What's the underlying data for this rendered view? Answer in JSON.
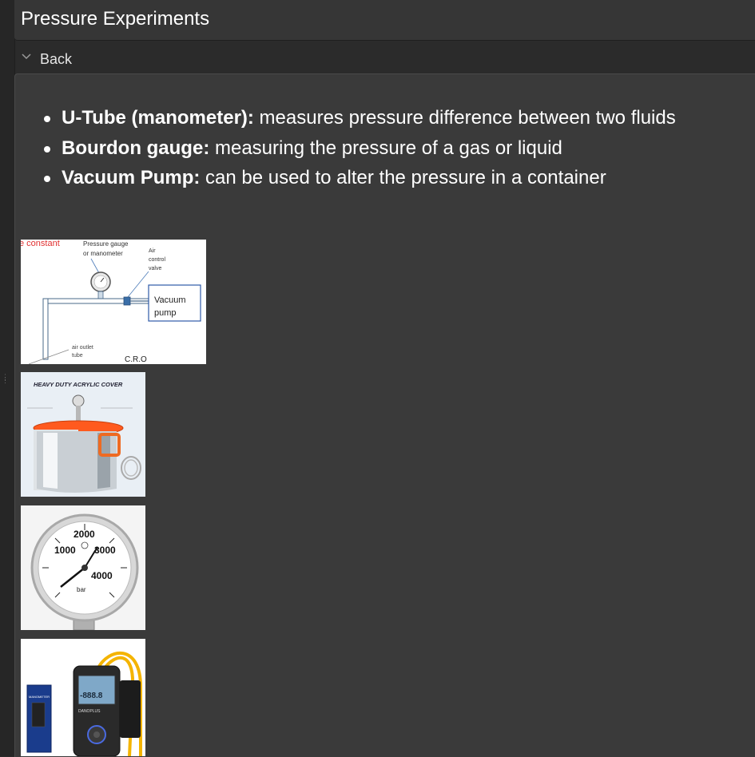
{
  "header": {
    "title": "Pressure Experiments"
  },
  "nav": {
    "back_label": "Back"
  },
  "bullets": [
    {
      "term": "U-Tube (manometer):",
      "desc": " measures pressure difference between two fluids"
    },
    {
      "term": "Bourdon gauge:",
      "desc": " measuring the pressure of a gas or liquid"
    },
    {
      "term": "Vacuum Pump:",
      "desc": " can be used to alter the pressure in a container"
    }
  ],
  "diagram": {
    "constant_text": "e constant",
    "gauge_label_1": "Pressure gauge",
    "gauge_label_2": "or manometer",
    "valve_label_1": "Air",
    "valve_label_2": "control",
    "valve_label_3": "valve",
    "pump_label_1": "Vacuum",
    "pump_label_2": "pump",
    "outlet_label_1": "air outlet",
    "outlet_label_2": "tube",
    "cro_label": "C.R.O"
  },
  "chamber_photo": {
    "caption": "HEAVY DUTY ACRYLIC COVER"
  },
  "gauge_photo": {
    "v2000": "2000",
    "v1000": "1000",
    "v3000": "3000",
    "v4000": "4000",
    "unit": "bar"
  },
  "manometer_photo": {
    "display": "-888.8",
    "box_text": "MANOMETER",
    "brand": "DANOPLUS"
  },
  "colors": {
    "background": "#2b2b2b",
    "panel": "#3a3a3a",
    "title_bar": "#363636",
    "accent_red": "#e03030"
  }
}
